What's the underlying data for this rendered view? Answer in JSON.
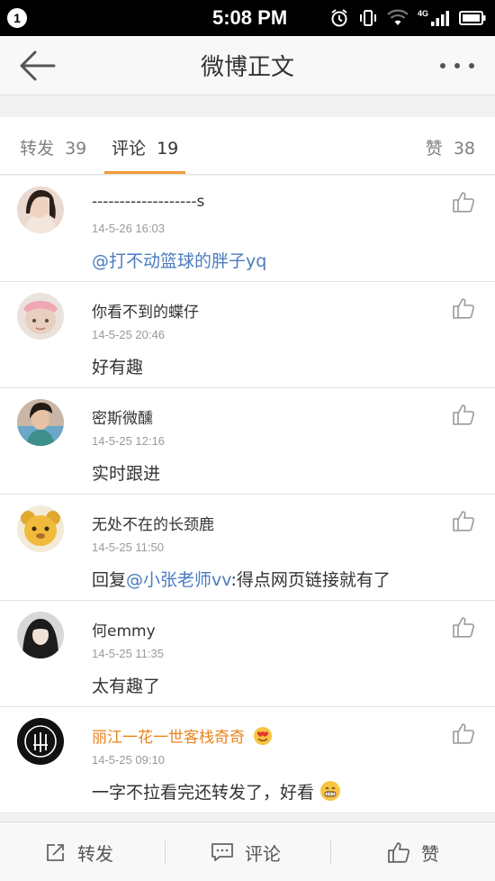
{
  "status_bar": {
    "notification_count": "1",
    "time": "5:08 PM",
    "network": "4G"
  },
  "header": {
    "title": "微博正文"
  },
  "tabs": {
    "repost": {
      "label": "转发",
      "count": "39"
    },
    "comment": {
      "label": "评论",
      "count": "19"
    },
    "like": {
      "label": "赞",
      "count": "38"
    }
  },
  "comments": [
    {
      "user": "-------------------s",
      "time": "14-5-26 16:03",
      "text_prefix": "",
      "mention": "@打不动篮球的胖子yq",
      "text_suffix": ""
    },
    {
      "user": "你看不到的蝶仔",
      "time": "14-5-25 20:46",
      "text_prefix": "好有趣",
      "mention": "",
      "text_suffix": ""
    },
    {
      "user": "密斯微醺",
      "time": "14-5-25 12:16",
      "text_prefix": "实时跟进",
      "mention": "",
      "text_suffix": ""
    },
    {
      "user": "无处不在的长颈鹿",
      "time": "14-5-25 11:50",
      "text_prefix": "回复",
      "mention": "@小张老师vv",
      "text_suffix": ":得点网页链接就有了"
    },
    {
      "user": "何emmy",
      "time": "14-5-25 11:35",
      "text_prefix": "太有趣了",
      "mention": "",
      "text_suffix": ""
    },
    {
      "user": "丽江一花一世客栈奇奇",
      "time": "14-5-25 09:10",
      "text_prefix": "一字不拉看完还转发了，好看",
      "mention": "",
      "text_suffix": ""
    }
  ],
  "bottom_bar": {
    "repost_label": "转发",
    "comment_label": "评论",
    "like_label": "赞"
  },
  "colors": {
    "accent": "#f29b38",
    "mention": "#4a7bbf",
    "vip_name": "#e8841c"
  },
  "icons": [
    "back-arrow-icon",
    "more-icon",
    "thumbs-up-icon",
    "repost-icon",
    "comment-icon",
    "alarm-icon",
    "vibrate-icon",
    "wifi-icon",
    "signal-icon",
    "battery-icon",
    "grin-emoji-icon",
    "love-emoji-icon"
  ]
}
